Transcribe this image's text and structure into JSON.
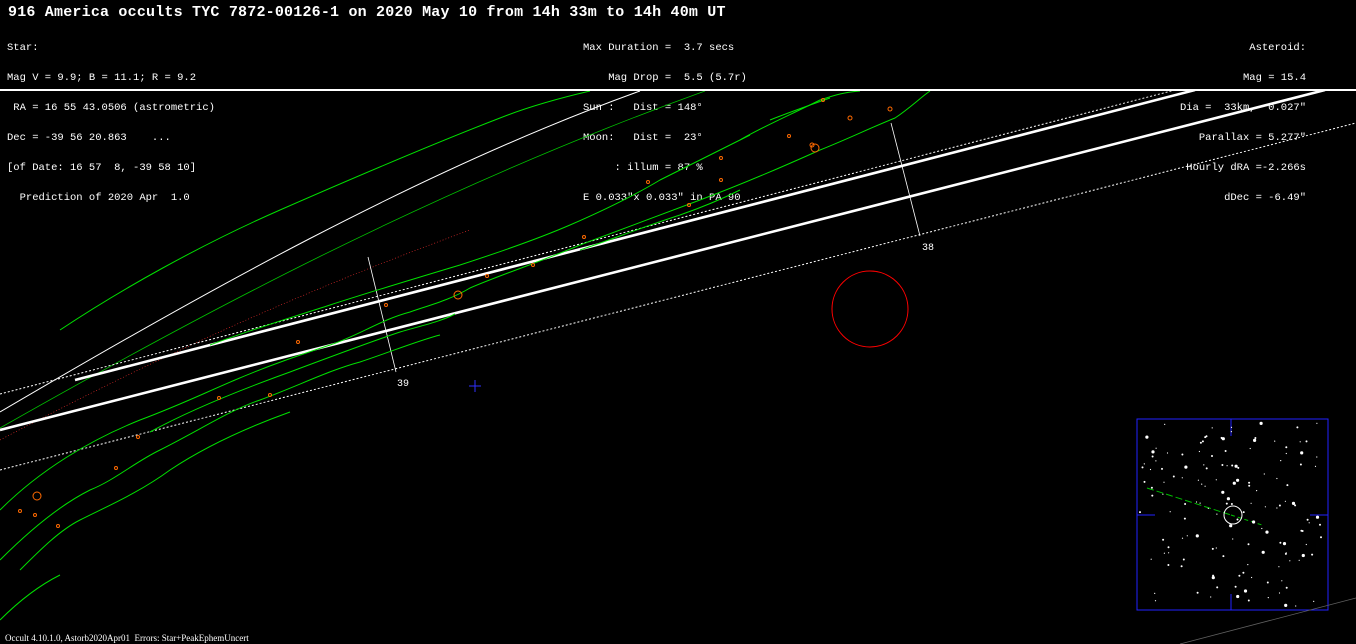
{
  "title": "916 America occults TYC 7872-00126-1 on 2020 May 10 from 14h 33m to 14h 40m UT",
  "star_info": [
    "Star:",
    "Mag V = 9.9; B = 11.1; R = 9.2",
    " RA = 16 55 43.0506 (astrometric)",
    "Dec = -39 56 20.863    ...",
    "[of Date: 16 57  8, -39 58 10]",
    "  Prediction of 2020 Apr  1.0"
  ],
  "event_info": [
    "Max Duration =  3.7 secs",
    "    Mag Drop =  5.5 (5.7r)",
    "Sun :   Dist = 148°",
    "Moon:   Dist =  23°",
    "     : illum = 87 %",
    "E 0.033\"x 0.033\" in PA 90"
  ],
  "asteroid_info": [
    "Asteroid:",
    "Mag = 15.4",
    "Dia =  33km,  0.027\"",
    "Parallax = 5.277\"",
    "Hourly dRA =-2.266s",
    "dDec = -6.49\""
  ],
  "time_markers": [
    {
      "label": "38"
    },
    {
      "label": "39"
    }
  ],
  "footer": "Occult 4.10.1.0, Astorb2020Apr01  Errors: Star+PeakEphemUncert",
  "colors": {
    "background": "#000000",
    "text": "#ffffff",
    "coastline": "#00e000",
    "site": "#ff6a00",
    "moon": "#ff0000",
    "center_cross": "#3030ff",
    "finder_frame": "#2222ff",
    "path_edge": "#ffffff"
  },
  "icons": {
    "moon": "red-circle",
    "site": "orange-small-circle",
    "sub_point": "blue-cross",
    "target_star": "white-circle"
  }
}
